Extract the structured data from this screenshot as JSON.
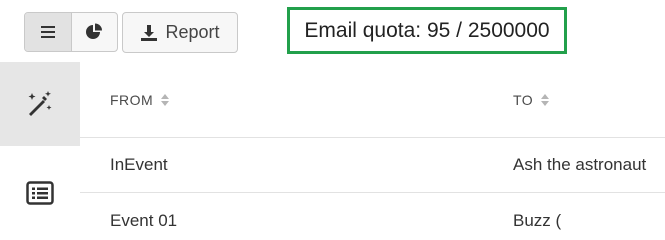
{
  "toolbar": {
    "view_toggle": [
      {
        "icon": "list-icon",
        "active": true
      },
      {
        "icon": "pie-chart-icon",
        "active": false
      }
    ],
    "report_button": {
      "label": "Report",
      "icon": "download-icon"
    }
  },
  "quota": {
    "text": "Email quota: 95 / 2500000",
    "border_color": "#22a04b"
  },
  "sidebar": {
    "items": [
      {
        "icon": "magic-wand-icon",
        "active": true
      },
      {
        "icon": "list-alt-icon",
        "active": false
      }
    ]
  },
  "table": {
    "columns": [
      {
        "label": "FROM",
        "sortable": true
      },
      {
        "label": "TO",
        "sortable": true
      }
    ],
    "rows": [
      {
        "from": "InEvent",
        "to": "Ash the astronaut"
      },
      {
        "from": "Event 01",
        "to": "Buzz ("
      }
    ]
  }
}
